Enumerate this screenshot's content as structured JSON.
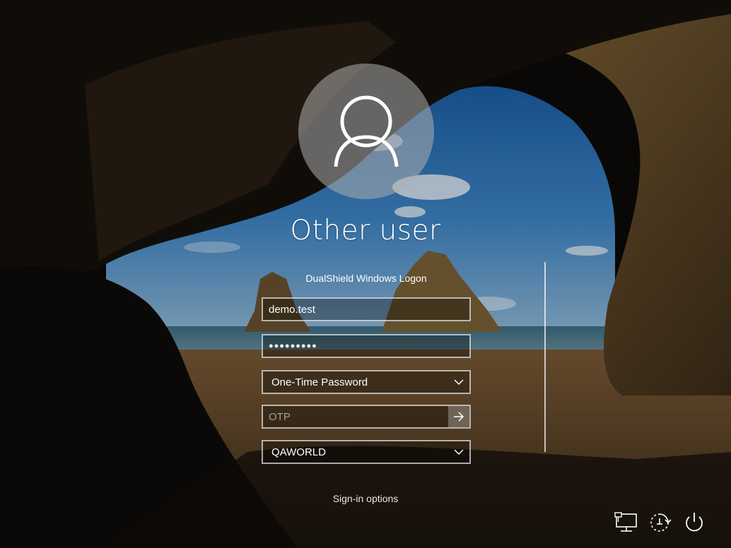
{
  "user": {
    "name": "Other user",
    "avatar_icon": "user-silhouette-icon"
  },
  "provider": {
    "title": "DualShield Windows Logon"
  },
  "fields": {
    "username": {
      "value": "demo.test"
    },
    "password": {
      "masked_value": "●●●●●●●●●"
    },
    "auth_method": {
      "selected": "One-Time Password"
    },
    "otp": {
      "placeholder": "OTP",
      "value": ""
    },
    "domain": {
      "selected": "QAWORLD"
    }
  },
  "links": {
    "sign_in_options": "Sign-in options"
  },
  "system_icons": [
    "network-icon",
    "ease-of-access-icon",
    "power-icon"
  ],
  "colors": {
    "text": "#ffffff",
    "field_border": "#d0d0d0",
    "avatar_bg": "#9a9a9a",
    "submit_bg": "#6a6a6a"
  }
}
